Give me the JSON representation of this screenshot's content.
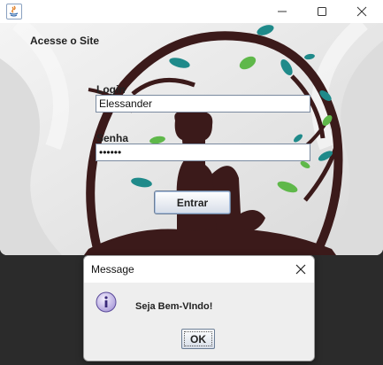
{
  "main_window": {
    "header_label": "Acesse o Site",
    "login_label": "Login",
    "login_value": "Elessander",
    "senha_label": "Senha",
    "senha_value": "••••••",
    "entrar_label": "Entrar"
  },
  "dialog": {
    "title": "Message",
    "message": "Seja Bem-VIndo!",
    "ok_label": "OK"
  },
  "colors": {
    "tree": "#3b1a1a",
    "leaf_teal": "#1f8a8a",
    "leaf_green": "#5fb84a"
  },
  "icons": {
    "app": "java-icon",
    "minimize": "minimize-icon",
    "maximize": "maximize-icon",
    "close": "close-icon",
    "info": "info-icon"
  }
}
